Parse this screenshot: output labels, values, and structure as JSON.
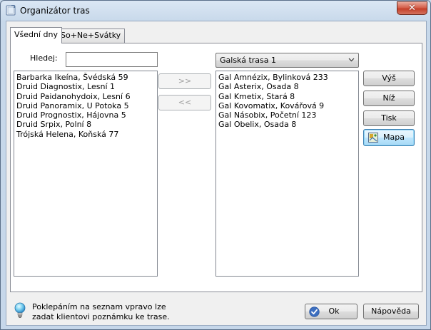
{
  "window": {
    "title": "Organizátor tras"
  },
  "tabs": [
    {
      "label": "Všední dny"
    },
    {
      "label": "So+Ne+Svátky"
    }
  ],
  "search": {
    "label": "Hledej:",
    "value": ""
  },
  "left_list": {
    "items": [
      "Barbarka Ikeína, Švédská 59",
      "Druid Diagnostix, Lesní 1",
      "Druid Paidanohydoix, Lesní 6",
      "Druid Panoramix, U Potoka 5",
      "Druid Prognostix, Hájovna 5",
      "Druid Srpix, Polní 8",
      "Trójská Helena, Koňská 77"
    ]
  },
  "transfer": {
    "add_label": ">>",
    "remove_label": "<<"
  },
  "route_select": {
    "selected": "Galská trasa 1"
  },
  "right_list": {
    "items": [
      "Gal Amnézix, Bylinková 233",
      "Gal Asterix, Osada 8",
      "Gal Kmetix, Stará 8",
      "Gal Kovomatix, Kovářová 9",
      "Gal Násobix, Početní 123",
      "Gal Obelix, Osada 8"
    ]
  },
  "side_buttons": {
    "up": "Výš",
    "down": "Níž",
    "print": "Tisk",
    "map": "Mapa"
  },
  "footer": {
    "hint_line1": "Poklepáním na seznam vpravo lze",
    "hint_line2": "zadat klientovi poznámku ke trase.",
    "ok_label": "Ok",
    "help_label": "Nápověda"
  }
}
